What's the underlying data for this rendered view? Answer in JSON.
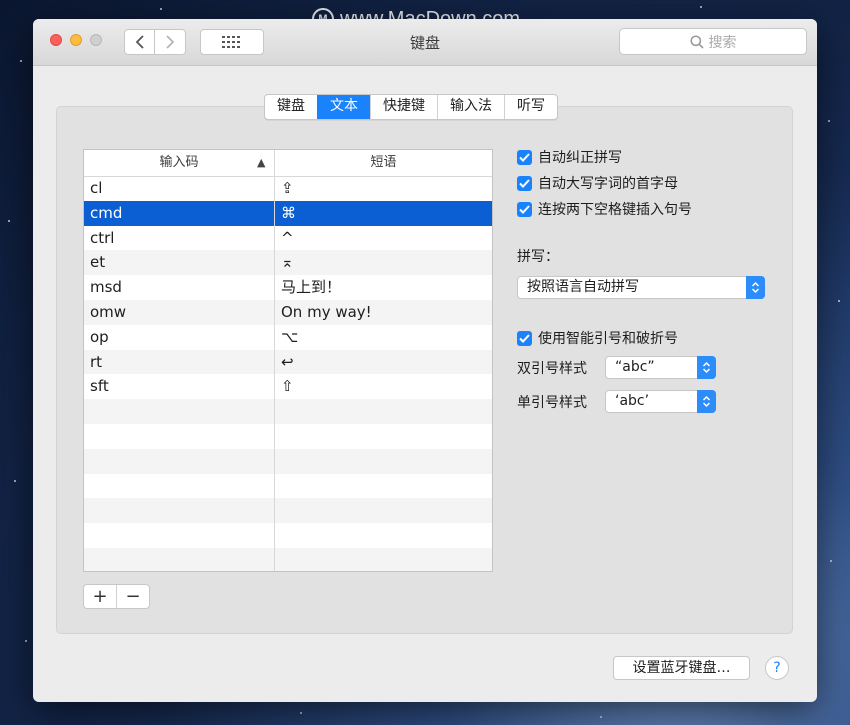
{
  "watermark": {
    "text": "www.MacDown.com",
    "logo": "M"
  },
  "window": {
    "title": "键盘"
  },
  "search": {
    "placeholder": "搜索"
  },
  "tabs": [
    {
      "label": "键盘",
      "active": false
    },
    {
      "label": "文本",
      "active": true
    },
    {
      "label": "快捷键",
      "active": false
    },
    {
      "label": "输入法",
      "active": false
    },
    {
      "label": "听写",
      "active": false
    }
  ],
  "table": {
    "headers": {
      "replace": "输入码",
      "with": "短语"
    },
    "rows": [
      {
        "replace": "cl",
        "with": "⇪"
      },
      {
        "replace": "cmd",
        "with": "⌘"
      },
      {
        "replace": "ctrl",
        "with": "^"
      },
      {
        "replace": "et",
        "with": "⌅"
      },
      {
        "replace": "msd",
        "with": "马上到！"
      },
      {
        "replace": "omw",
        "with": "On my way!"
      },
      {
        "replace": "op",
        "with": "⌥"
      },
      {
        "replace": "rt",
        "with": "↩"
      },
      {
        "replace": "sft",
        "with": "⇧"
      }
    ],
    "selected_index": 1
  },
  "controls": {
    "add": "+",
    "remove": "−"
  },
  "options": {
    "auto_correct": {
      "label": "自动纠正拼写",
      "checked": true
    },
    "auto_capitalize": {
      "label": "自动大写字词的首字母",
      "checked": true
    },
    "double_space_period": {
      "label": "连按两下空格键插入句号",
      "checked": true
    },
    "spelling_label": "拼写：",
    "spelling_value": "按照语言自动拼写",
    "smart_quotes": {
      "label": "使用智能引号和破折号",
      "checked": true
    },
    "double_quote_label": "双引号样式",
    "double_quote_value": "“abc”",
    "single_quote_label": "单引号样式",
    "single_quote_value": "‘abc’"
  },
  "footer": {
    "bluetooth_button": "设置蓝牙键盘…",
    "help": "?"
  },
  "colors": {
    "accent": "#1a82fb",
    "selection": "#0c5fd2"
  }
}
